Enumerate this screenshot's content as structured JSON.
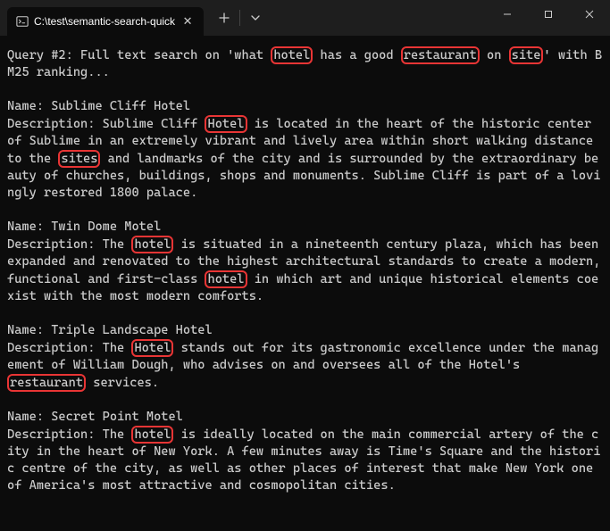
{
  "window": {
    "tab_title": "C:\\test\\semantic-search-quick",
    "tab_icon_name": "terminal-icon"
  },
  "query": {
    "prefix": "Query #2: Full text search on 'what ",
    "hl1": "hotel",
    "mid1": " has a good ",
    "hl2": "restaurant",
    "mid2": " on ",
    "hl3": "site",
    "suffix": "' with BM25 ranking..."
  },
  "results": [
    {
      "name_label": "Name: ",
      "name": "Sublime Cliff Hotel",
      "desc_label": "Description: ",
      "segments": [
        {
          "t": "Sublime Cliff "
        },
        {
          "t": "Hotel",
          "hl": true
        },
        {
          "t": " is located in the heart of the historic center of Sublime in an extremely vibrant and lively area within short walking distance to the "
        },
        {
          "t": "sites",
          "hl": true
        },
        {
          "t": " and landmarks of the city and is surrounded by the extraordinary beauty of churches, buildings, shops and monuments. Sublime Cliff is part of a lovingly restored 1800 palace."
        }
      ]
    },
    {
      "name_label": "Name: ",
      "name": "Twin Dome Motel",
      "desc_label": "Description: ",
      "segments": [
        {
          "t": "The "
        },
        {
          "t": "hotel",
          "hl": true
        },
        {
          "t": " is situated in a  nineteenth century plaza, which has been expanded and renovated to the highest architectural standards to create a modern, functional and first-class "
        },
        {
          "t": "hotel",
          "hl": true
        },
        {
          "t": " in which art and unique historical elements coexist with the most modern comforts."
        }
      ]
    },
    {
      "name_label": "Name: ",
      "name": "Triple Landscape Hotel",
      "desc_label": "Description: ",
      "segments": [
        {
          "t": "The "
        },
        {
          "t": "Hotel",
          "hl": true
        },
        {
          "t": " stands out for its gastronomic excellence under the management of William Dough, who advises on and oversees all of the Hotel's "
        },
        {
          "t": "restaurant",
          "hl": true
        },
        {
          "t": " services."
        }
      ]
    },
    {
      "name_label": "Name: ",
      "name": "Secret Point Motel",
      "desc_label": "Description: ",
      "segments": [
        {
          "t": "The "
        },
        {
          "t": "hotel",
          "hl": true
        },
        {
          "t": " is ideally located on the main commercial artery of the city in the heart of New York. A few minutes away is Time's Square and the historic centre of the city, as well as other places of interest that make New York one of America's most attractive and cosmopolitan cities."
        }
      ]
    }
  ]
}
